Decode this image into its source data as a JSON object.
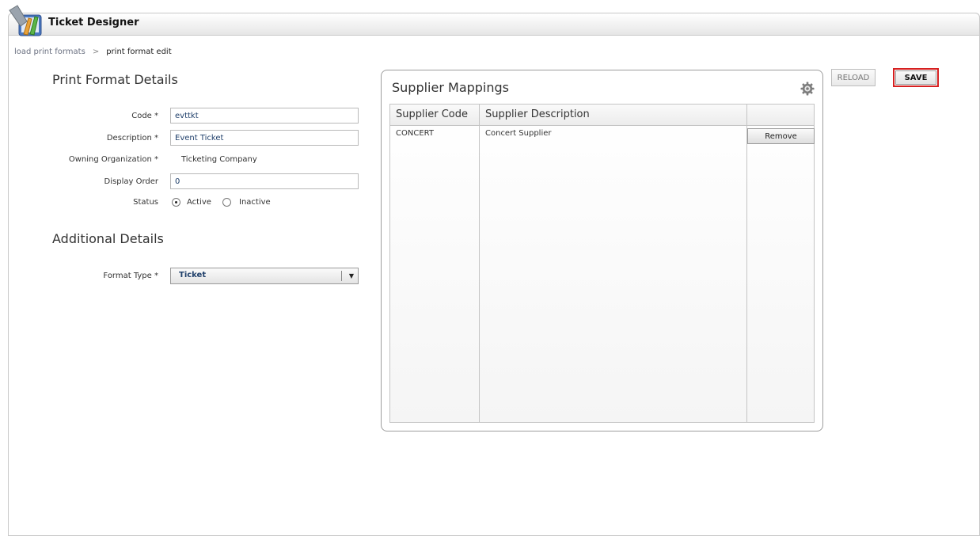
{
  "app": {
    "title": "Ticket Designer",
    "icon": "ticket-designer-logo-icon"
  },
  "breadcrumb": {
    "link": "load print formats",
    "separator": ">",
    "current": "print format edit"
  },
  "print_format_details": {
    "heading": "Print Format Details",
    "code": {
      "label": "Code *",
      "value": "evttkt"
    },
    "description": {
      "label": "Description *",
      "value": "Event Ticket"
    },
    "owning_org": {
      "label": "Owning Organization *",
      "value": "Ticketing Company"
    },
    "display_order": {
      "label": "Display Order",
      "value": "0"
    },
    "status": {
      "label": "Status",
      "options": [
        "Active",
        "Inactive"
      ],
      "selected": "Active"
    }
  },
  "additional_details": {
    "heading": "Additional Details",
    "format_type": {
      "label": "Format Type *",
      "value": "Ticket"
    }
  },
  "supplier_mappings": {
    "title": "Supplier Mappings",
    "settings_icon": "gear-icon",
    "columns": [
      "Supplier Code",
      "Supplier Description",
      ""
    ],
    "rows": [
      {
        "code": "CONCERT",
        "description": "Concert Supplier",
        "action": "Remove"
      }
    ]
  },
  "toolbar": {
    "reload_label": "RELOAD",
    "save_label": "SAVE"
  }
}
